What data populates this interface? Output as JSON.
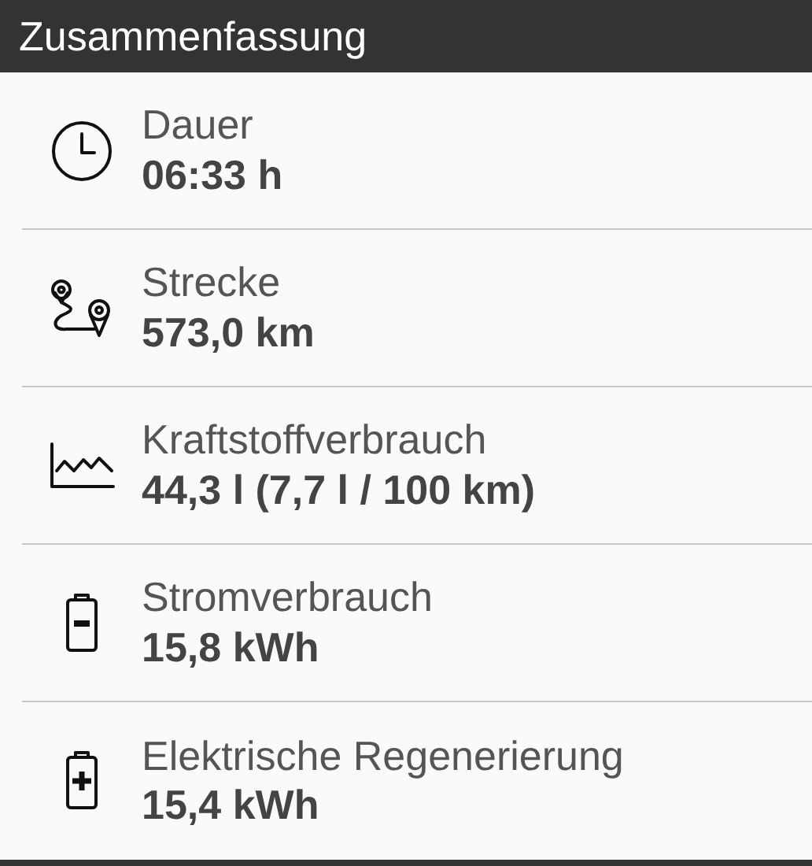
{
  "header": {
    "title": "Zusammenfassung"
  },
  "items": [
    {
      "kind": "clock",
      "label": "Dauer",
      "value": "06:33 h"
    },
    {
      "kind": "route",
      "label": "Strecke",
      "value": "573,0 km"
    },
    {
      "kind": "chart",
      "label": "Kraftstoffverbrauch",
      "value": "44,3 l (7,7 l / 100 km)"
    },
    {
      "kind": "battery-minus",
      "label": "Stromverbrauch",
      "value": "15,8 kWh"
    },
    {
      "kind": "battery-plus",
      "label": "Elektrische Regenerierung",
      "value": "15,4 kWh"
    }
  ]
}
